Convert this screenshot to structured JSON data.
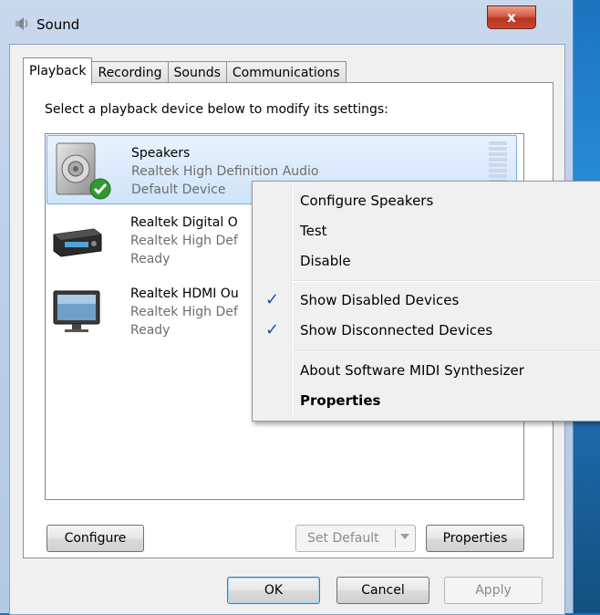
{
  "window": {
    "title": "Sound",
    "close_label": "x"
  },
  "tabs": [
    {
      "label": "Playback"
    },
    {
      "label": "Recording"
    },
    {
      "label": "Sounds"
    },
    {
      "label": "Communications"
    }
  ],
  "instruction": "Select a playback device below to modify its settings:",
  "devices": [
    {
      "name": "Speakers",
      "driver": "Realtek High Definition Audio",
      "status": "Default Device"
    },
    {
      "name": "Realtek Digital O",
      "driver": "Realtek High Def",
      "status": "Ready"
    },
    {
      "name": "Realtek HDMI Ou",
      "driver": "Realtek High Def",
      "status": "Ready"
    }
  ],
  "buttons": {
    "configure": "Configure",
    "set_default": "Set Default",
    "properties": "Properties",
    "ok": "OK",
    "cancel": "Cancel",
    "apply": "Apply"
  },
  "context_menu": {
    "items": [
      {
        "label": "Configure Speakers"
      },
      {
        "label": "Test"
      },
      {
        "label": "Disable"
      },
      {
        "label": "Show Disabled Devices",
        "checked": true
      },
      {
        "label": "Show Disconnected Devices",
        "checked": true
      },
      {
        "label": "About Software MIDI Synthesizer"
      },
      {
        "label": "Properties",
        "bold": true
      }
    ],
    "check_glyph": "✓"
  },
  "icons": {
    "title": "speaker-icon",
    "device_0": "speaker-device-icon",
    "device_1": "digital-receiver-icon",
    "device_2": "hdmi-monitor-icon",
    "default_badge": "green-check-icon"
  },
  "colors": {
    "selection": "#cfe4fb",
    "check": "#1c4fa8",
    "close_button": "#c8462c"
  }
}
